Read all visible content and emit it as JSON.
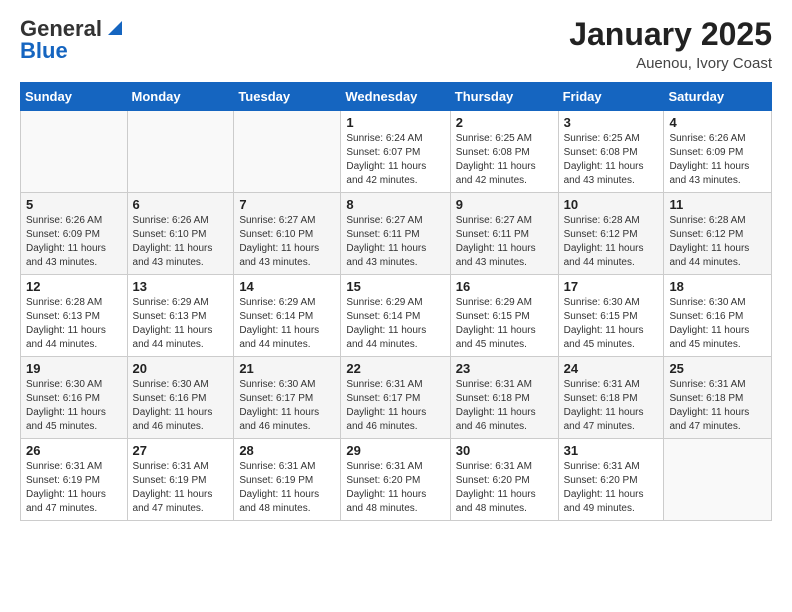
{
  "logo": {
    "general": "General",
    "blue": "Blue"
  },
  "title": "January 2025",
  "location": "Auenou, Ivory Coast",
  "days_of_week": [
    "Sunday",
    "Monday",
    "Tuesday",
    "Wednesday",
    "Thursday",
    "Friday",
    "Saturday"
  ],
  "weeks": [
    [
      {
        "day": "",
        "info": ""
      },
      {
        "day": "",
        "info": ""
      },
      {
        "day": "",
        "info": ""
      },
      {
        "day": "1",
        "info": "Sunrise: 6:24 AM\nSunset: 6:07 PM\nDaylight: 11 hours and 42 minutes."
      },
      {
        "day": "2",
        "info": "Sunrise: 6:25 AM\nSunset: 6:08 PM\nDaylight: 11 hours and 42 minutes."
      },
      {
        "day": "3",
        "info": "Sunrise: 6:25 AM\nSunset: 6:08 PM\nDaylight: 11 hours and 43 minutes."
      },
      {
        "day": "4",
        "info": "Sunrise: 6:26 AM\nSunset: 6:09 PM\nDaylight: 11 hours and 43 minutes."
      }
    ],
    [
      {
        "day": "5",
        "info": "Sunrise: 6:26 AM\nSunset: 6:09 PM\nDaylight: 11 hours and 43 minutes."
      },
      {
        "day": "6",
        "info": "Sunrise: 6:26 AM\nSunset: 6:10 PM\nDaylight: 11 hours and 43 minutes."
      },
      {
        "day": "7",
        "info": "Sunrise: 6:27 AM\nSunset: 6:10 PM\nDaylight: 11 hours and 43 minutes."
      },
      {
        "day": "8",
        "info": "Sunrise: 6:27 AM\nSunset: 6:11 PM\nDaylight: 11 hours and 43 minutes."
      },
      {
        "day": "9",
        "info": "Sunrise: 6:27 AM\nSunset: 6:11 PM\nDaylight: 11 hours and 43 minutes."
      },
      {
        "day": "10",
        "info": "Sunrise: 6:28 AM\nSunset: 6:12 PM\nDaylight: 11 hours and 44 minutes."
      },
      {
        "day": "11",
        "info": "Sunrise: 6:28 AM\nSunset: 6:12 PM\nDaylight: 11 hours and 44 minutes."
      }
    ],
    [
      {
        "day": "12",
        "info": "Sunrise: 6:28 AM\nSunset: 6:13 PM\nDaylight: 11 hours and 44 minutes."
      },
      {
        "day": "13",
        "info": "Sunrise: 6:29 AM\nSunset: 6:13 PM\nDaylight: 11 hours and 44 minutes."
      },
      {
        "day": "14",
        "info": "Sunrise: 6:29 AM\nSunset: 6:14 PM\nDaylight: 11 hours and 44 minutes."
      },
      {
        "day": "15",
        "info": "Sunrise: 6:29 AM\nSunset: 6:14 PM\nDaylight: 11 hours and 44 minutes."
      },
      {
        "day": "16",
        "info": "Sunrise: 6:29 AM\nSunset: 6:15 PM\nDaylight: 11 hours and 45 minutes."
      },
      {
        "day": "17",
        "info": "Sunrise: 6:30 AM\nSunset: 6:15 PM\nDaylight: 11 hours and 45 minutes."
      },
      {
        "day": "18",
        "info": "Sunrise: 6:30 AM\nSunset: 6:16 PM\nDaylight: 11 hours and 45 minutes."
      }
    ],
    [
      {
        "day": "19",
        "info": "Sunrise: 6:30 AM\nSunset: 6:16 PM\nDaylight: 11 hours and 45 minutes."
      },
      {
        "day": "20",
        "info": "Sunrise: 6:30 AM\nSunset: 6:16 PM\nDaylight: 11 hours and 46 minutes."
      },
      {
        "day": "21",
        "info": "Sunrise: 6:30 AM\nSunset: 6:17 PM\nDaylight: 11 hours and 46 minutes."
      },
      {
        "day": "22",
        "info": "Sunrise: 6:31 AM\nSunset: 6:17 PM\nDaylight: 11 hours and 46 minutes."
      },
      {
        "day": "23",
        "info": "Sunrise: 6:31 AM\nSunset: 6:18 PM\nDaylight: 11 hours and 46 minutes."
      },
      {
        "day": "24",
        "info": "Sunrise: 6:31 AM\nSunset: 6:18 PM\nDaylight: 11 hours and 47 minutes."
      },
      {
        "day": "25",
        "info": "Sunrise: 6:31 AM\nSunset: 6:18 PM\nDaylight: 11 hours and 47 minutes."
      }
    ],
    [
      {
        "day": "26",
        "info": "Sunrise: 6:31 AM\nSunset: 6:19 PM\nDaylight: 11 hours and 47 minutes."
      },
      {
        "day": "27",
        "info": "Sunrise: 6:31 AM\nSunset: 6:19 PM\nDaylight: 11 hours and 47 minutes."
      },
      {
        "day": "28",
        "info": "Sunrise: 6:31 AM\nSunset: 6:19 PM\nDaylight: 11 hours and 48 minutes."
      },
      {
        "day": "29",
        "info": "Sunrise: 6:31 AM\nSunset: 6:20 PM\nDaylight: 11 hours and 48 minutes."
      },
      {
        "day": "30",
        "info": "Sunrise: 6:31 AM\nSunset: 6:20 PM\nDaylight: 11 hours and 48 minutes."
      },
      {
        "day": "31",
        "info": "Sunrise: 6:31 AM\nSunset: 6:20 PM\nDaylight: 11 hours and 49 minutes."
      },
      {
        "day": "",
        "info": ""
      }
    ]
  ]
}
